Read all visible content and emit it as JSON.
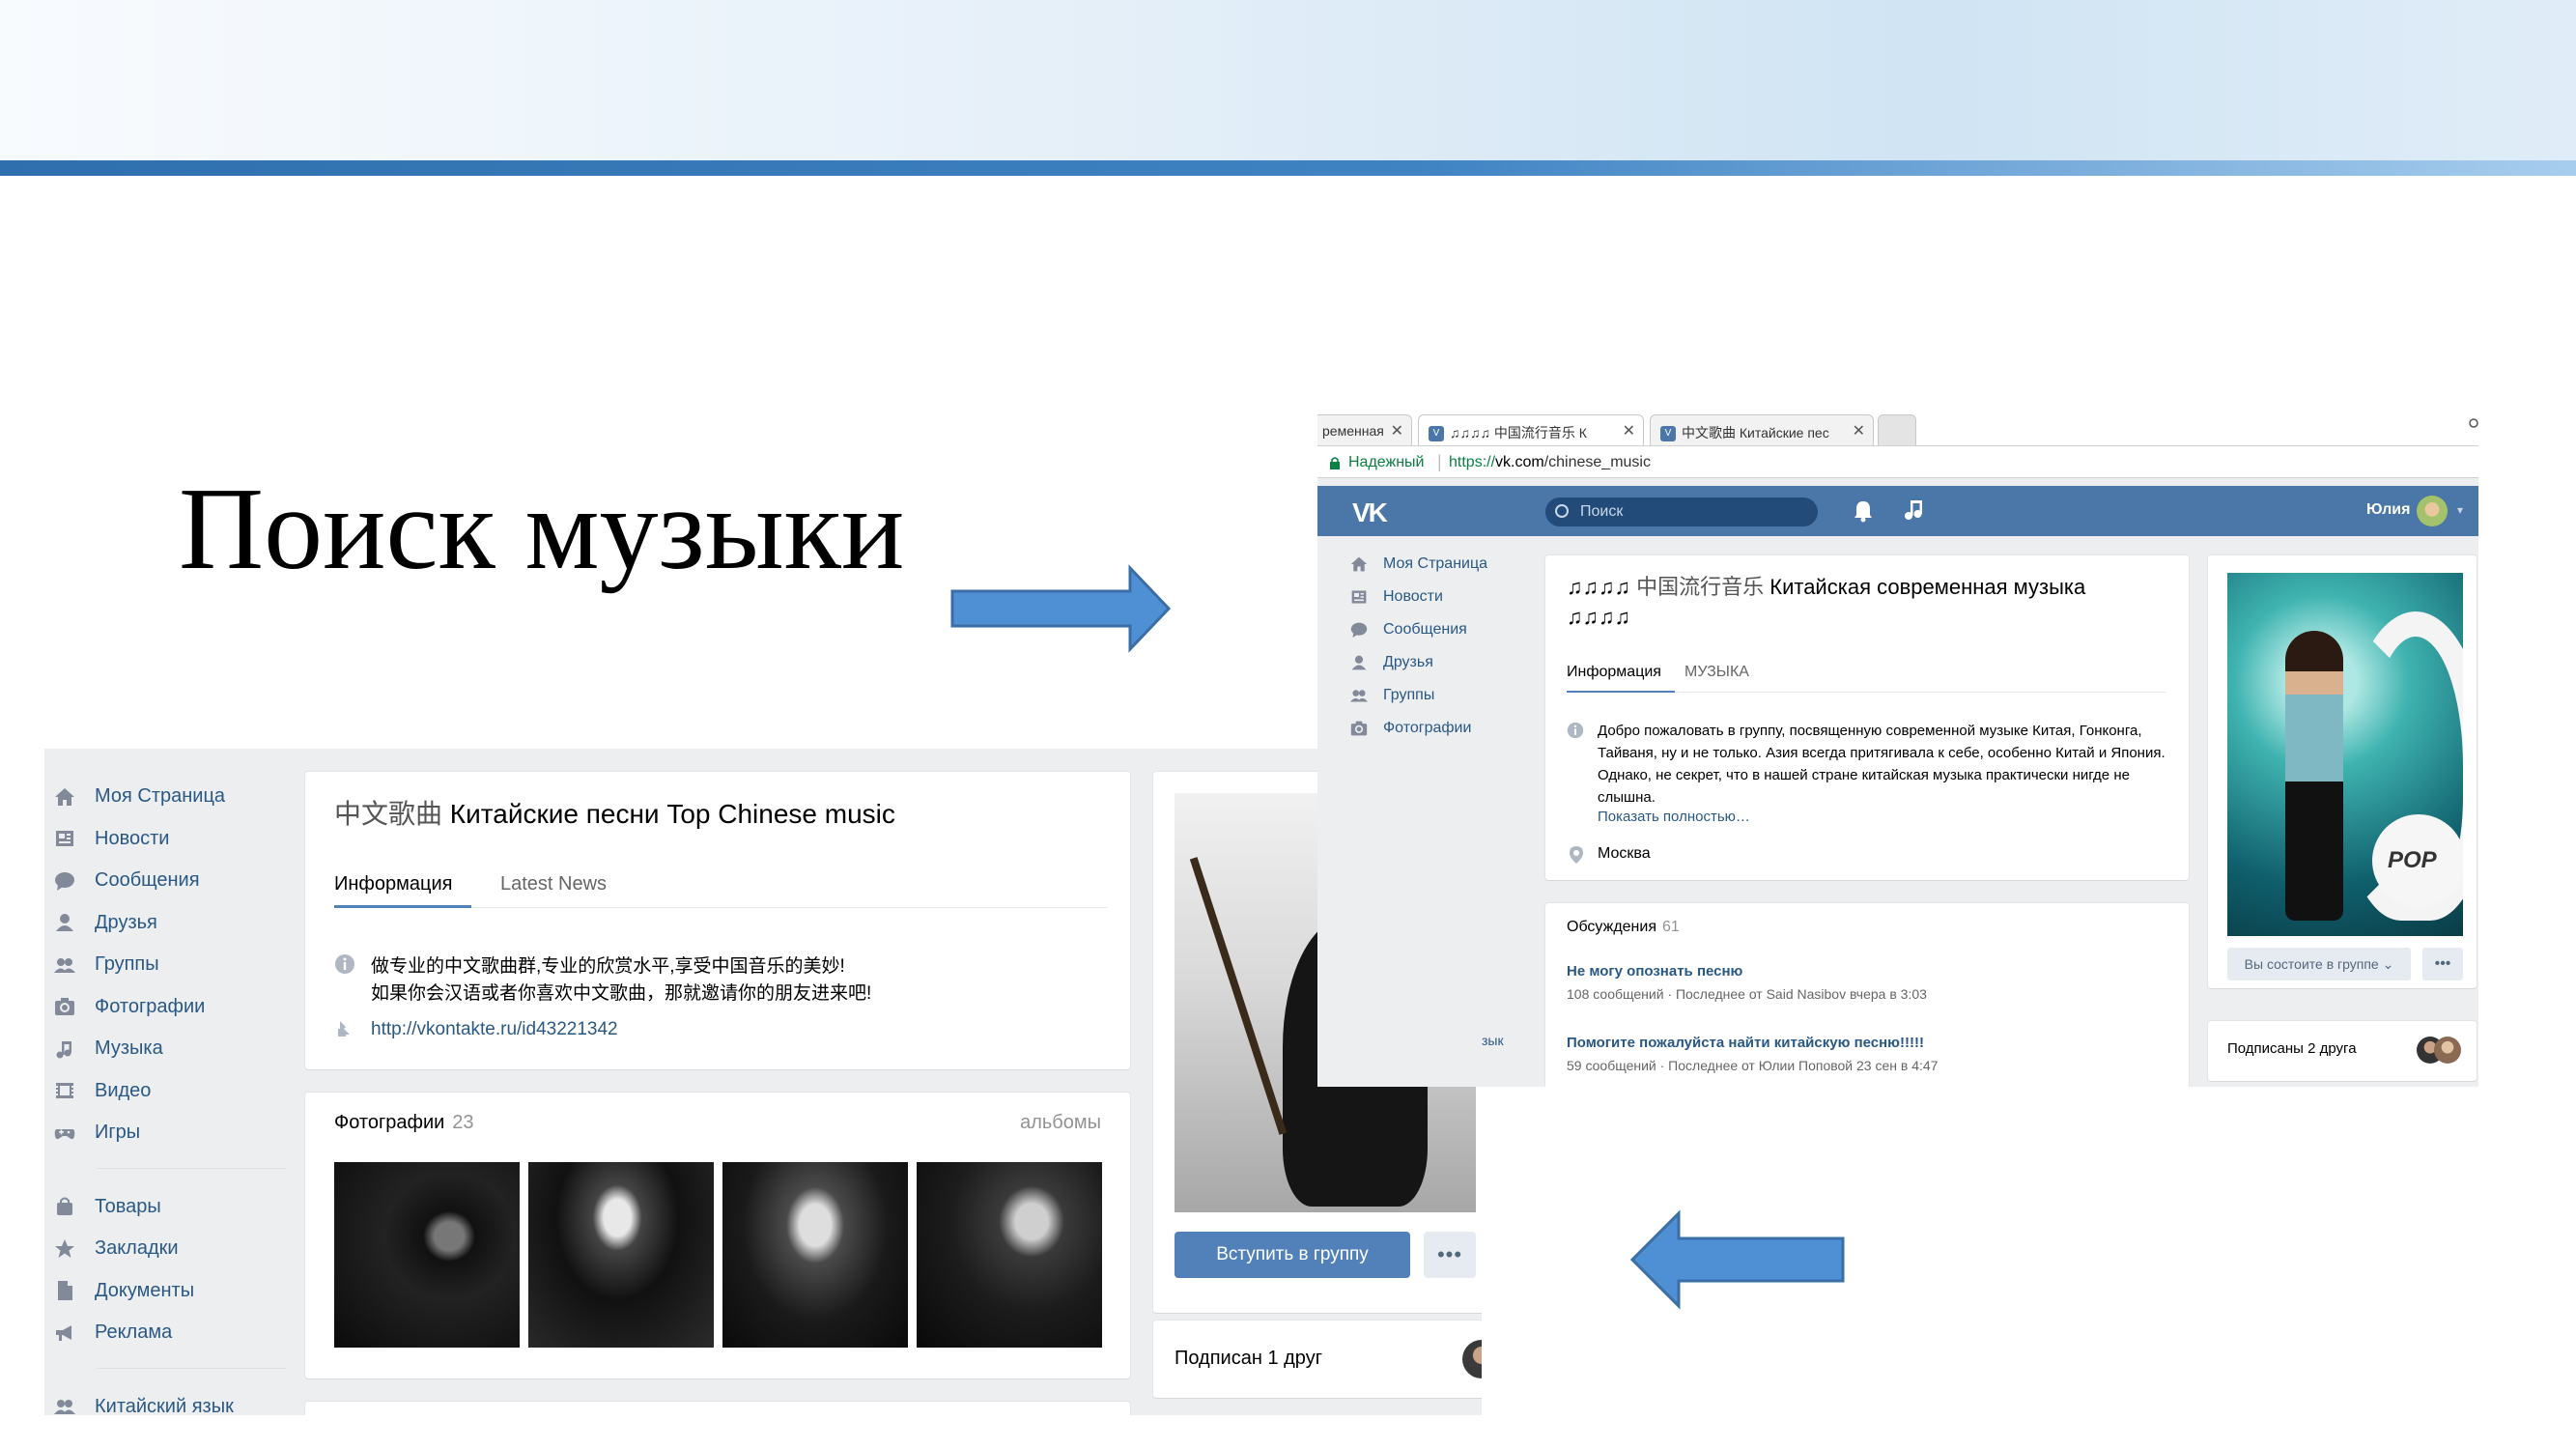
{
  "slide": {
    "title": "Поиск музыки",
    "colors": {
      "accent": "#3f83c3",
      "arrow_fill": "#4f8fd4",
      "arrow_stroke": "#3a6ea5"
    }
  },
  "screenshot_left": {
    "sidebar": {
      "items": [
        {
          "label": "Моя Страница",
          "icon": "home-icon"
        },
        {
          "label": "Новости",
          "icon": "news-icon"
        },
        {
          "label": "Сообщения",
          "icon": "messages-icon"
        },
        {
          "label": "Друзья",
          "icon": "friends-icon"
        },
        {
          "label": "Группы",
          "icon": "groups-icon"
        },
        {
          "label": "Фотографии",
          "icon": "camera-icon"
        },
        {
          "label": "Музыка",
          "icon": "music-note-icon"
        },
        {
          "label": "Видео",
          "icon": "video-icon"
        },
        {
          "label": "Игры",
          "icon": "gamepad-icon"
        }
      ],
      "items2": [
        {
          "label": "Товары",
          "icon": "shopping-bag-icon"
        },
        {
          "label": "Закладки",
          "icon": "star-icon"
        },
        {
          "label": "Документы",
          "icon": "document-icon"
        },
        {
          "label": "Реклама",
          "icon": "megaphone-icon"
        }
      ],
      "items3": [
        {
          "label": "Китайский язык",
          "icon": "groups-icon"
        }
      ]
    },
    "group": {
      "title_cn": "中文歌曲",
      "title": "Китайские песни Top Chinese music",
      "tabs": [
        "Информация",
        "Latest News"
      ],
      "info_line1": "做专业的中文歌曲群,专业的欣赏水平,享受中国音乐的美妙!",
      "info_line2": "如果你会汉语或者你喜欢中文歌曲，那就邀请你的朋友进来吧!",
      "link": "http://vkontakte.ru/id43221342"
    },
    "photos": {
      "title": "Фотографии",
      "count": "23",
      "albums": "альбомы"
    },
    "join_button": "Вступить в группу",
    "more_button": "•••",
    "friends": "Подписан 1 друг"
  },
  "screenshot_right": {
    "browser": {
      "tabs": [
        {
          "label": "ременная"
        },
        {
          "label": "♫♫♫♫ 中国流行音乐 К"
        },
        {
          "label": "中文歌曲 Китайские пес"
        }
      ],
      "secure_label": "Надежный",
      "url_scheme": "https://",
      "url_host": "vk.com",
      "url_path": "/chinese_music"
    },
    "header": {
      "logo": "VK",
      "search_placeholder": "Поиск",
      "user_name": "Юлия"
    },
    "sidebar": {
      "items": [
        {
          "label": "Моя Страница",
          "icon": "home-icon"
        },
        {
          "label": "Новости",
          "icon": "news-icon"
        },
        {
          "label": "Сообщения",
          "icon": "messages-icon"
        },
        {
          "label": "Друзья",
          "icon": "friends-icon"
        },
        {
          "label": "Группы",
          "icon": "groups-icon"
        },
        {
          "label": "Фотографии",
          "icon": "camera-icon"
        }
      ],
      "cut_label": "зык"
    },
    "group": {
      "title_notes": "♫♫♫♫",
      "title_cn": "中国流行音乐",
      "title": "Китайская современная музыка",
      "tabs": [
        "Информация",
        "МУЗЫКА"
      ],
      "description": "Добро пожаловать в группу, посвященную современной музыке Китая, Гонконга, Тайваня, ну и не только. Азия всегда притягивала к себе, особенно Китай и Япония. Однако, не секрет, что в нашей стране китайская музыка практически нигде не слышна.",
      "show_more": "Показать полностью…",
      "city": "Москва"
    },
    "discussions": {
      "title": "Обсуждения",
      "count": "61",
      "topics": [
        {
          "title": "Не могу опознать песню",
          "meta": "108 сообщений · Последнее от Said Nasibov вчера в 3:03"
        },
        {
          "title": "Помогите пожалуйста найти китайскую песню!!!!!",
          "meta": "59 сообщений · Последнее от Юлии Поповой 23 сен в 4:47"
        }
      ]
    },
    "member_button": "Вы состоите в группе ⌄",
    "more_button": "•••",
    "friends": "Подписаны 2 друга",
    "poster_logo": "POP"
  }
}
